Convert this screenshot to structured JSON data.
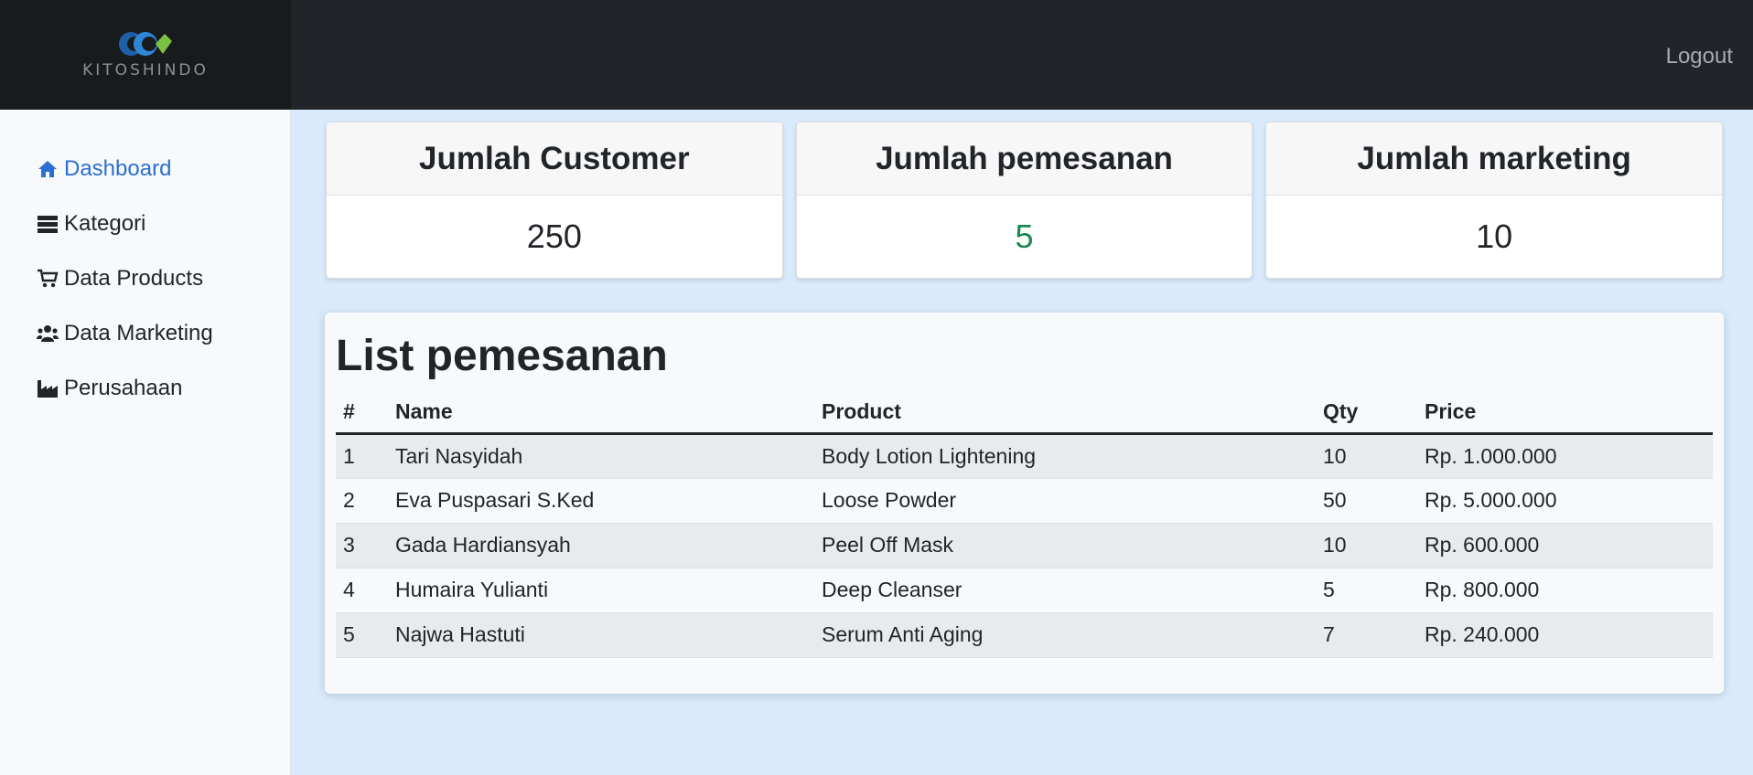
{
  "brand": {
    "name": "KITOSHINDO"
  },
  "header": {
    "logout_label": "Logout"
  },
  "sidebar": {
    "items": [
      {
        "label": "Dashboard",
        "icon": "home-icon",
        "active": true
      },
      {
        "label": "Kategori",
        "icon": "list-icon"
      },
      {
        "label": "Data Products",
        "icon": "cart-icon"
      },
      {
        "label": "Data Marketing",
        "icon": "users-icon"
      },
      {
        "label": "Perusahaan",
        "icon": "industry-icon"
      }
    ]
  },
  "stats": [
    {
      "title": "Jumlah Customer",
      "value": "250"
    },
    {
      "title": "Jumlah pemesanan",
      "value": "5"
    },
    {
      "title": "Jumlah marketing",
      "value": "10"
    }
  ],
  "orders": {
    "title": "List pemesanan",
    "columns": [
      "#",
      "Name",
      "Product",
      "Qty",
      "Price"
    ],
    "rows": [
      [
        "1",
        "Tari Nasyidah",
        "Body Lotion Lightening",
        "10",
        "Rp. 1.000.000"
      ],
      [
        "2",
        "Eva Puspasari S.Ked",
        "Loose Powder",
        "50",
        "Rp. 5.000.000"
      ],
      [
        "3",
        "Gada Hardiansyah",
        "Peel Off Mask",
        "10",
        "Rp. 600.000"
      ],
      [
        "4",
        "Humaira Yulianti",
        "Deep Cleanser",
        "5",
        "Rp. 800.000"
      ],
      [
        "5",
        "Najwa Hastuti",
        "Serum Anti Aging",
        "7",
        "Rp. 240.000"
      ]
    ]
  },
  "colors": {
    "topbar": "#212529",
    "accent": "#2a6fd1",
    "success": "#198754",
    "background": "#d8eafb"
  }
}
